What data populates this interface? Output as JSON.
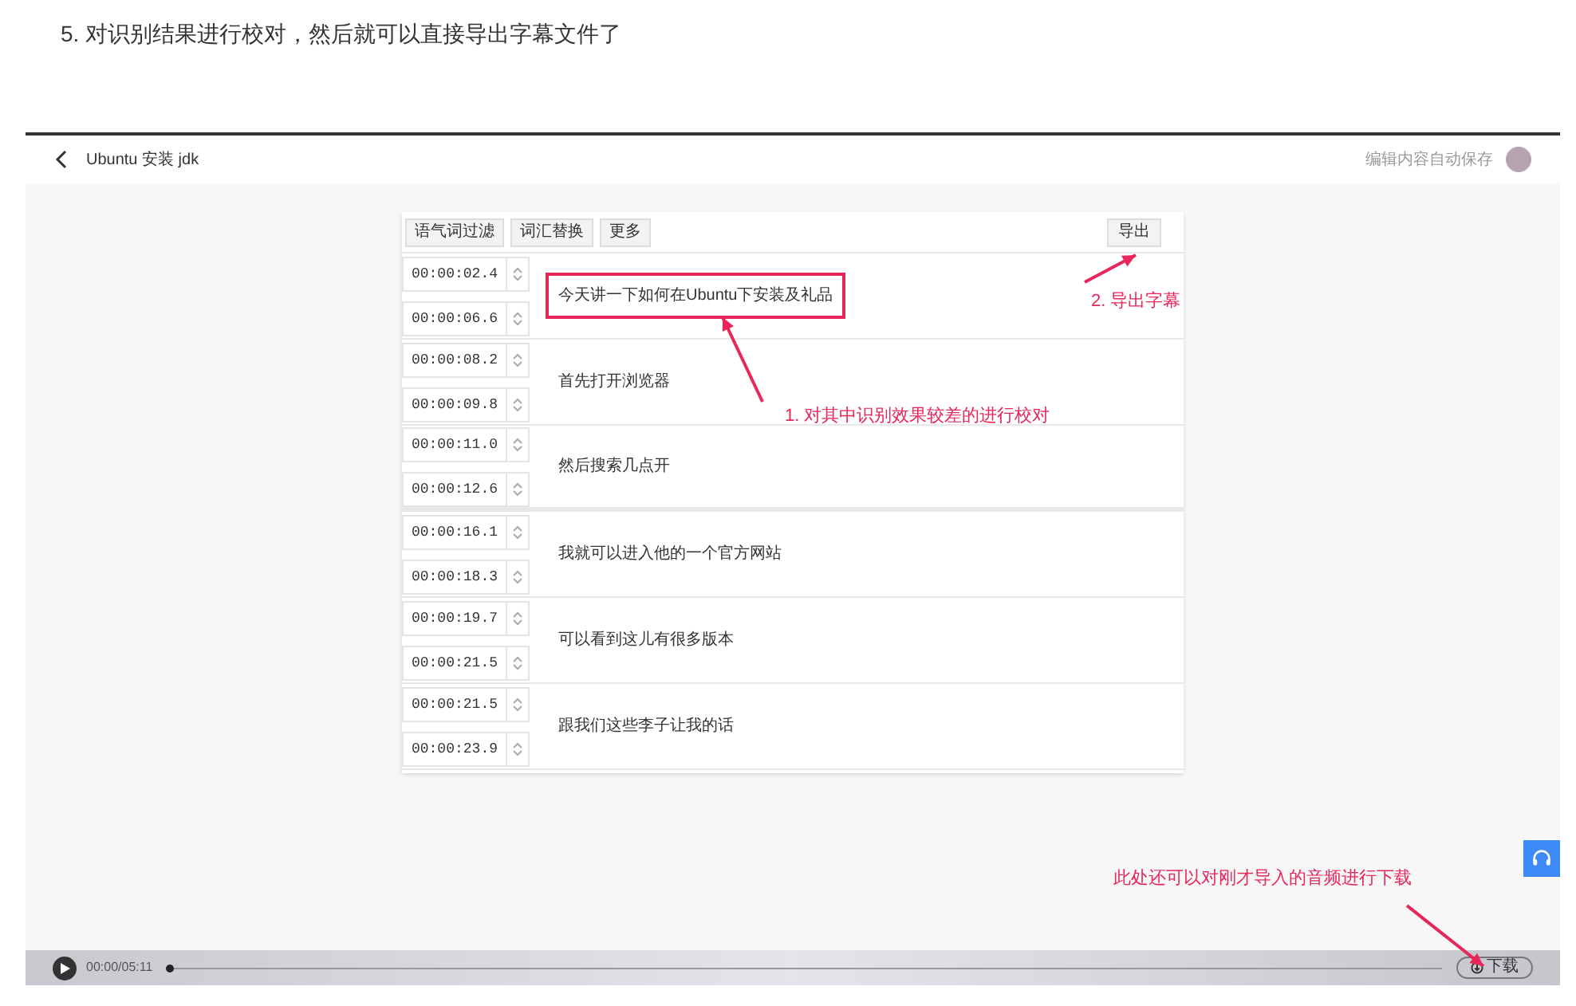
{
  "heading": "5. 对识别结果进行校对，然后就可以直接导出字幕文件了",
  "screenshot": {
    "header": {
      "title": "Ubuntu 安装 jdk",
      "autosave_note": "编辑内容自动保存"
    },
    "toolbar": {
      "buttons": [
        "语气词过滤",
        "词汇替换",
        "更多"
      ],
      "export_button": "导出"
    },
    "rows": [
      {
        "start": "00:00:02.4",
        "end": "00:00:06.6",
        "text": "今天讲一下如何在Ubuntu下安装及礼品",
        "highlighted": true
      },
      {
        "start": "00:00:08.2",
        "end": "00:00:09.8",
        "text": "首先打开浏览器",
        "highlighted": false
      },
      {
        "start": "00:00:11.0",
        "end": "00:00:12.6",
        "text": "然后搜索几点开",
        "highlighted": false
      },
      {
        "start": "00:00:16.1",
        "end": "00:00:18.3",
        "text": "我就可以进入他的一个官方网站",
        "highlighted": false
      },
      {
        "start": "00:00:19.7",
        "end": "00:00:21.5",
        "text": "可以看到这儿有很多版本",
        "highlighted": false
      },
      {
        "start": "00:00:21.5",
        "end": "00:00:23.9",
        "text": "跟我们这些李子让我的话",
        "highlighted": false
      }
    ],
    "player": {
      "time": "00:00/05:11",
      "level": 0,
      "download_button": "下载"
    },
    "annotations": [
      "1. 对其中识别效果较差的进行校对",
      "2. 导出字幕",
      "此处还可以对刚才导入的音频进行下载"
    ]
  }
}
